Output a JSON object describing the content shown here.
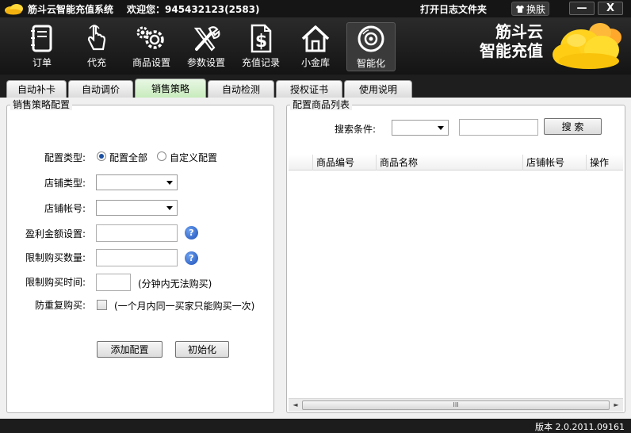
{
  "window": {
    "title": "筋斗云智能充值系统",
    "welcome": "欢迎您：945432123(2583)",
    "open_log": "打开日志文件夹",
    "skin": "换肤",
    "minimize": "—",
    "close": "X"
  },
  "toolbar": {
    "items": [
      {
        "label": "订单",
        "icon": "notebook-icon"
      },
      {
        "label": "代充",
        "icon": "hand-pointer-icon"
      },
      {
        "label": "商品设置",
        "icon": "gears-icon"
      },
      {
        "label": "参数设置",
        "icon": "tools-icon"
      },
      {
        "label": "充值记录",
        "icon": "dollar-document-icon"
      },
      {
        "label": "小金库",
        "icon": "house-icon"
      },
      {
        "label": "智能化",
        "icon": "disc-icon"
      }
    ],
    "active_index": 6
  },
  "brand": {
    "line1": "筋斗云",
    "line2": "智能充值"
  },
  "tabs": [
    {
      "label": "自动补卡"
    },
    {
      "label": "自动调价"
    },
    {
      "label": "销售策略"
    },
    {
      "label": "自动检测"
    },
    {
      "label": "授权证书"
    },
    {
      "label": "使用说明"
    }
  ],
  "active_tab": 2,
  "left_panel": {
    "title": "销售策略配置",
    "config_type_label": "配置类型:",
    "radio_all": "配置全部",
    "radio_custom": "自定义配置",
    "radio_selected": "all",
    "shop_type_label": "店铺类型:",
    "shop_type_value": "",
    "shop_account_label": "店铺帐号:",
    "shop_account_value": "",
    "profit_label": "盈利金额设置:",
    "profit_value": "",
    "limit_qty_label": "限制购买数量:",
    "limit_qty_value": "",
    "limit_time_label": "限制购买时间:",
    "limit_time_value": "",
    "limit_time_hint": "(分钟内无法购买)",
    "dup_label": "防重复购买:",
    "dup_hint": "(一个月内同一买家只能购买一次)",
    "dup_checked": false,
    "add_button": "添加配置",
    "init_button": "初始化",
    "help_glyph": "?"
  },
  "right_panel": {
    "title": "配置商品列表",
    "search_label": "搜索条件:",
    "search_value": "",
    "search_button": "搜 索",
    "columns": [
      "商品编号",
      "商品名称",
      "店铺帐号",
      "操作"
    ],
    "rows": [],
    "scroll_left": "◄",
    "scroll_right": "►",
    "scroll_grip": "III"
  },
  "status": {
    "version": "版本 2.0.2011.09161"
  },
  "colors": {
    "dark_bg": "#1e1e1e",
    "tab_active": "#c8ebbd",
    "help_blue": "#1c4fb8"
  }
}
